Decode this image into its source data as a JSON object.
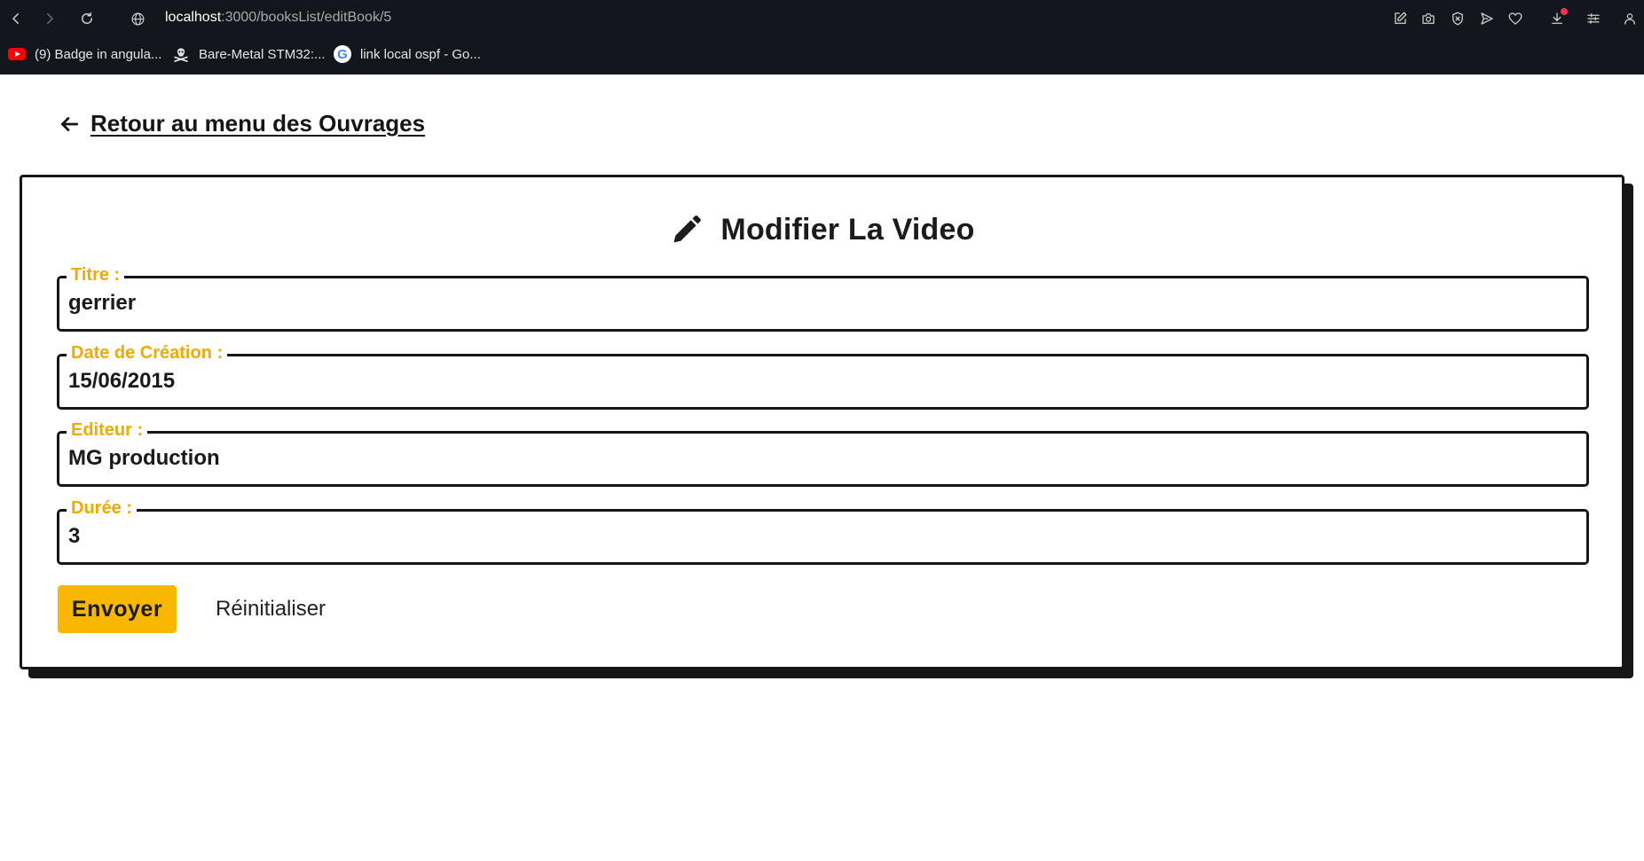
{
  "browser": {
    "url_host": "localhost",
    "url_path": ":3000/booksList/editBook/5",
    "bookmarks": [
      {
        "label": "(9) Badge in angula...",
        "icon": "youtube-icon"
      },
      {
        "label": "Bare-Metal STM32:...",
        "icon": "skull-crossbones-icon"
      },
      {
        "label": "link local ospf - Go...",
        "icon": "google-icon"
      }
    ],
    "colors": {
      "chrome_bg": "#14161d",
      "download_badge": "#ff2f4f"
    }
  },
  "page": {
    "back_link": "Retour au menu des Ouvrages",
    "form_title": "Modifier La Video",
    "title_icon": "pencil-icon",
    "fields": [
      {
        "label": "Titre :",
        "value": "gerrier"
      },
      {
        "label": "Date de Création :",
        "value": "15/06/2015"
      },
      {
        "label": "Editeur :",
        "value": "MG production"
      },
      {
        "label": "Durée :",
        "value": "3"
      }
    ],
    "submit_label": "Envoyer",
    "reset_label": "Réinitialiser",
    "colors": {
      "accent": "#f8b700",
      "label": "#f2a900",
      "border": "#161616"
    }
  }
}
